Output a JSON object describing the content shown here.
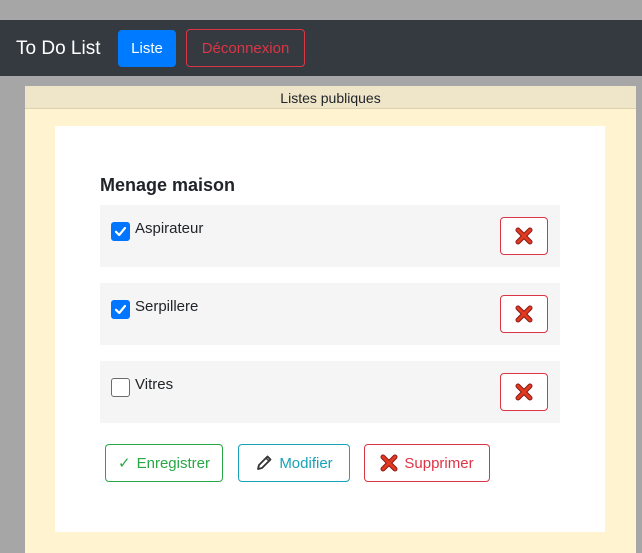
{
  "navbar": {
    "brand": "To Do List",
    "liste_label": "Liste",
    "logout_label": "Déconnexion"
  },
  "section": {
    "header": "Listes publiques"
  },
  "list": {
    "title": "Menage maison",
    "items": [
      {
        "label": "Aspirateur",
        "checked": true
      },
      {
        "label": "Serpillere",
        "checked": true
      },
      {
        "label": "Vitres",
        "checked": false
      }
    ]
  },
  "actions": {
    "save_check": "✓",
    "save_label": "Enregistrer",
    "edit_label": "Modifier",
    "delete_label": "Supprimer"
  },
  "colors": {
    "navbar": "#343a40",
    "primary": "#007bff",
    "danger": "#dc3545",
    "success": "#28a745",
    "info": "#17a2b8",
    "section_background": "#fff4cf"
  },
  "icons": {
    "delete_item": "red-x-icon",
    "edit": "pencil-icon",
    "delete_list": "red-x-icon"
  }
}
